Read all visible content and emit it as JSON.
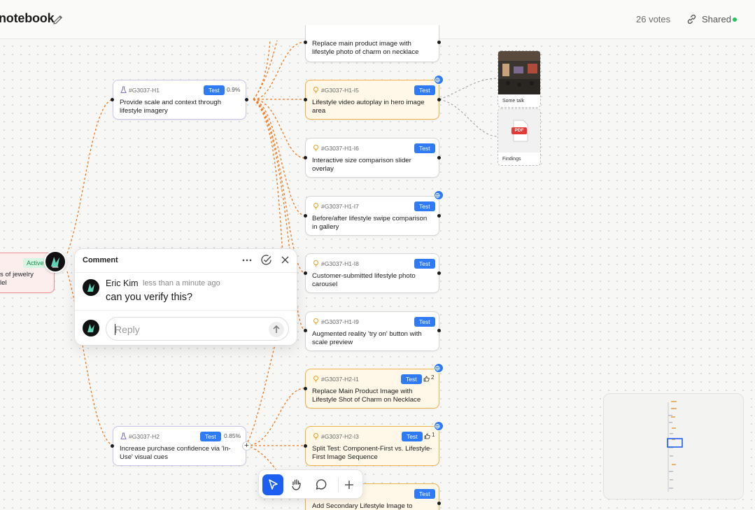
{
  "header": {
    "title": "notebook",
    "votes": "26 votes",
    "share_label": "Shared",
    "share_status_color": "#22c55e"
  },
  "colors": {
    "accent": "#2f7bf5",
    "idea_border": "#f2b14a",
    "connector_orange": "#f07a1e"
  },
  "objective": {
    "status": "Active",
    "text_line1": "s of jewelry",
    "text_line2": "lel"
  },
  "hypotheses": [
    {
      "id": "#G3037-H1",
      "badge": "Test",
      "percent": "0.9%",
      "text": "Provide scale and context through lifestyle imagery",
      "icon": "flask-icon"
    },
    {
      "id": "#G3037-H2",
      "badge": "Test",
      "percent": "0.85%",
      "text": "Increase purchase confidence via 'In-Use' visual cues",
      "icon": "flask-icon"
    }
  ],
  "ideas": [
    {
      "id": "",
      "badge": "",
      "text": "Replace main product image with lifestyle photo of charm on necklace",
      "icon": ""
    },
    {
      "id": "#G3037-H1-I5",
      "badge": "Test",
      "text": "Lifestyle video autoplay in hero image area",
      "icon": "lightbulb-icon",
      "globe": true
    },
    {
      "id": "#G3037-H1-I6",
      "badge": "Test",
      "text": "Interactive size comparison slider overlay",
      "icon": "lightbulb-icon"
    },
    {
      "id": "#G3037-H1-I7",
      "badge": "Test",
      "text": "Before/after lifestyle swipe comparison in gallery",
      "icon": "lightbulb-icon",
      "globe": true
    },
    {
      "id": "#G3037-H1-I8",
      "badge": "Test",
      "text": "Customer-submitted lifestyle photo carousel",
      "icon": "lightbulb-icon"
    },
    {
      "id": "#G3037-H1-I9",
      "badge": "Test",
      "text": "Augmented reality 'try on' button with scale preview",
      "icon": "lightbulb-icon"
    },
    {
      "id": "#G3037-H2-I1",
      "badge": "Test",
      "likes": "2",
      "text": "Replace Main Product Image with Lifestyle Shot of Charm on Necklace",
      "icon": "lightbulb-icon",
      "globe": true
    },
    {
      "id": "#G3037-H2-I3",
      "badge": "Test",
      "likes": "1",
      "text": "Split Test: Component-First vs. Lifestyle-First Image Sequence",
      "icon": "lightbulb-icon",
      "globe": true
    },
    {
      "id": "",
      "badge": "Test",
      "text": "Add Secondary Lifestyle Image to",
      "icon": ""
    }
  ],
  "attachments": [
    {
      "label": "Some talk",
      "kind": "photo"
    },
    {
      "label": "Findings",
      "kind": "pdf",
      "pdf_tag": "PDF"
    }
  ],
  "comment": {
    "header": "Comment",
    "author": "Eric Kim",
    "time": "less than a minute ago",
    "message": "can you verify this?",
    "reply_placeholder": "Reply"
  },
  "toolbar": {
    "tools": [
      "select-tool",
      "hand-tool",
      "comment-tool",
      "add-tool"
    ],
    "active": "select-tool"
  }
}
